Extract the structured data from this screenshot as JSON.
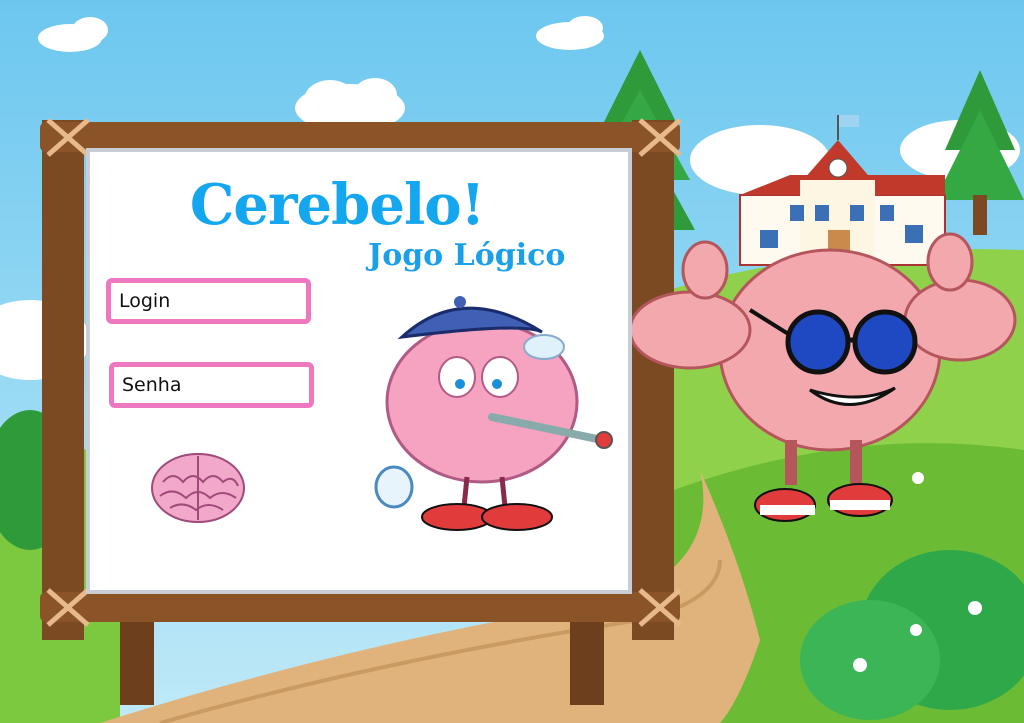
{
  "app": {
    "title": "Cerebelo!",
    "subtitle": "Jogo Lógico"
  },
  "form": {
    "login_placeholder": "Login",
    "password_placeholder": "Senha"
  },
  "colors": {
    "title": "#14a6ee",
    "field_border": "#ee78c0",
    "sky": "#7ccdf0",
    "grass": "#7cc940",
    "wood": "#7b4a22"
  },
  "icons": [
    "brain-logo-icon",
    "sick-brain-character",
    "muscle-brain-character",
    "school-building",
    "flag-icon"
  ]
}
